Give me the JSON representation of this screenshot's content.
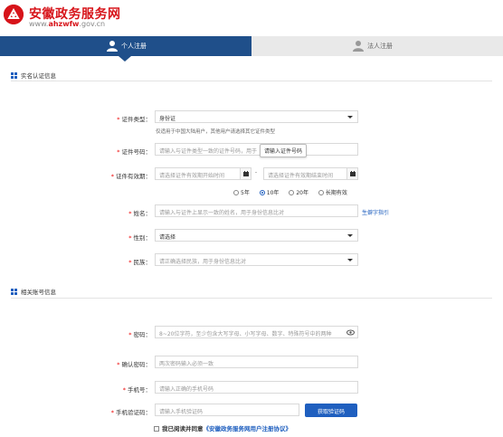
{
  "header": {
    "title": "安徽政务服务网",
    "url_prefix": "www.",
    "url_bold": "ahzwfw",
    "url_suffix": ".gov.cn"
  },
  "tabs": [
    {
      "label": "个人注册",
      "active": true
    },
    {
      "label": "法人注册",
      "active": false
    }
  ],
  "sections": {
    "identity": "实名认证信息",
    "account": "相关账号信息"
  },
  "form": {
    "id_type": {
      "label": "证件类型：",
      "value": "身份证",
      "hint": "仅适用于中国大陆用户，其他用户请选择其它证件类型"
    },
    "id_number": {
      "label": "证件号码：",
      "placeholder": "请输入与证件类型一致的证件号码，用于",
      "tooltip": "请输入证件号码"
    },
    "validity": {
      "label": "证件有效期：",
      "start_placeholder": "请选择证件有效期开始时间",
      "end_placeholder": "请选择证件有效期结束时间",
      "separator": "-",
      "options": [
        "5年",
        "10年",
        "20年",
        "长期有效"
      ],
      "selected": "10年"
    },
    "name": {
      "label": "姓名：",
      "placeholder": "请输入与证件上显示一致的姓名，用于身份信息比对",
      "link": "生僻字指引"
    },
    "gender": {
      "label": "性别：",
      "value": "请选择"
    },
    "ethnicity": {
      "label": "民族：",
      "value": "请正确选择民族，用于身份信息比对"
    },
    "password": {
      "label": "密码：",
      "placeholder": "8~20位字符，至少包含大写字母、小写字母、数字、特殊符号中的两种"
    },
    "confirm_password": {
      "label": "确认密码：",
      "placeholder": "两次密码输入必须一致"
    },
    "phone": {
      "label": "手机号：",
      "placeholder": "请输入正确的手机号码"
    },
    "code": {
      "label": "手机验证码：",
      "placeholder": "请输入手机验证码",
      "button": "获取验证码"
    },
    "agreement": {
      "prefix": "我已阅读并同意",
      "link": "《安徽政务服务网用户注册协议》"
    }
  },
  "colors": {
    "brand_red": "#d7141a",
    "tab_blue": "#1f4f8a",
    "link_blue": "#1f5fbf"
  }
}
